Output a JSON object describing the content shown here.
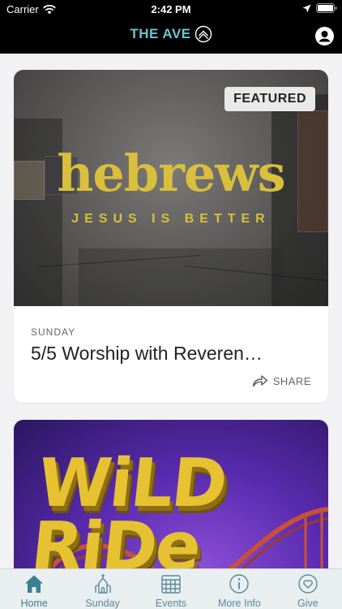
{
  "status_bar": {
    "carrier": "Carrier",
    "time": "2:42 PM"
  },
  "header": {
    "brand": "THE AVE"
  },
  "feed": {
    "cards": [
      {
        "badge": "FEATURED",
        "art_title": "hebrews",
        "art_subtitle": "JESUS IS BETTER",
        "kicker": "SUNDAY",
        "title": "5/5 Worship with Reveren…",
        "share_label": "SHARE"
      },
      {
        "art_title": "WiLD RiDe"
      }
    ]
  },
  "tabs": [
    {
      "label": "Home",
      "icon": "home-icon",
      "active": true
    },
    {
      "label": "Sunday",
      "icon": "church-icon",
      "active": false
    },
    {
      "label": "Events",
      "icon": "calendar-icon",
      "active": false
    },
    {
      "label": "More Info",
      "icon": "info-icon",
      "active": false
    },
    {
      "label": "Give",
      "icon": "heart-icon",
      "active": false
    }
  ],
  "colors": {
    "brand": "#6cc3cf",
    "accent_gold": "#d9bf3c",
    "tab_active": "#3d7f90"
  }
}
